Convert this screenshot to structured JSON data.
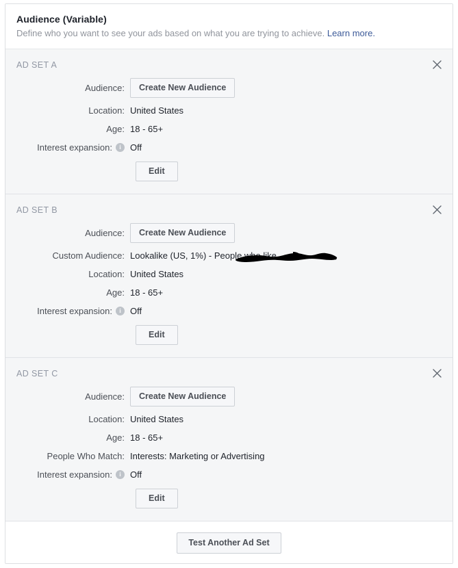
{
  "header": {
    "title": "Audience (Variable)",
    "description": "Define who you want to see your ads based on what you are trying to achieve.",
    "learn_more_label": "Learn more.",
    "link_color": "#3b5998"
  },
  "icons": {
    "close": "close-icon",
    "info": "info-icon",
    "info_glyph": "i"
  },
  "common": {
    "create_audience_label": "Create New Audience",
    "edit_label": "Edit",
    "labels": {
      "audience": "Audience:",
      "location": "Location:",
      "age": "Age:",
      "interest_expansion": "Interest expansion:",
      "custom_audience": "Custom Audience:",
      "people_who_match": "People Who Match:"
    }
  },
  "adsets": [
    {
      "name": "AD SET A",
      "audience_button": "Create New Audience",
      "location_label": "Location:",
      "location_value": "United States",
      "age_label": "Age:",
      "age_value": "18 - 65+",
      "interest_label": "Interest expansion:",
      "interest_value": "Off",
      "edit_label": "Edit"
    },
    {
      "name": "AD SET B",
      "audience_button": "Create New Audience",
      "custom_audience_label": "Custom Audience:",
      "custom_audience_value": "Lookalike (US, 1%) - People who like",
      "custom_audience_redacted": true,
      "location_label": "Location:",
      "location_value": "United States",
      "age_label": "Age:",
      "age_value": "18 - 65+",
      "interest_label": "Interest expansion:",
      "interest_value": "Off",
      "edit_label": "Edit"
    },
    {
      "name": "AD SET C",
      "audience_button": "Create New Audience",
      "location_label": "Location:",
      "location_value": "United States",
      "age_label": "Age:",
      "age_value": "18 - 65+",
      "people_match_label": "People Who Match:",
      "people_match_value": "Interests: Marketing or Advertising",
      "interest_label": "Interest expansion:",
      "interest_value": "Off",
      "edit_label": "Edit"
    }
  ],
  "footer": {
    "test_another_label": "Test Another Ad Set"
  }
}
